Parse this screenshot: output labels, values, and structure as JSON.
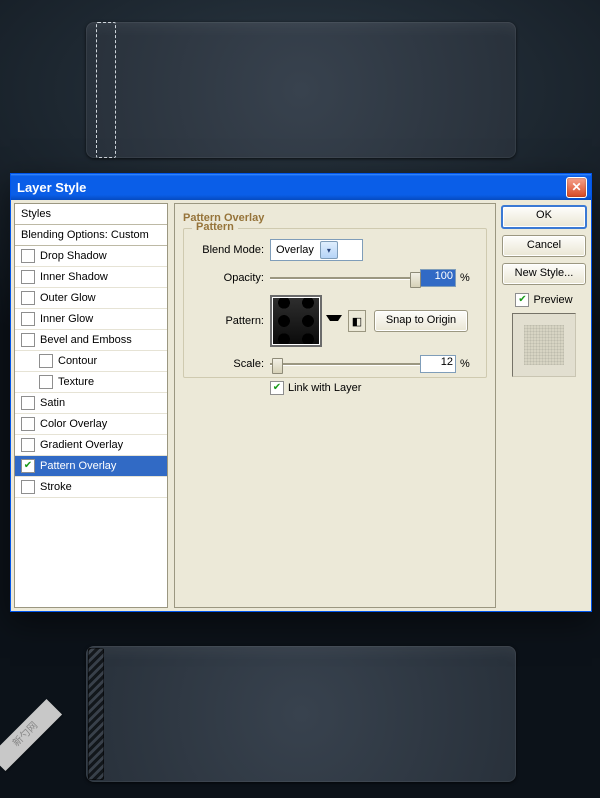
{
  "watermark": "新勺网",
  "dialog": {
    "title": "Layer Style",
    "left": {
      "header": "Styles",
      "sub": "Blending Options: Custom",
      "items": [
        {
          "label": "Drop Shadow",
          "checked": false
        },
        {
          "label": "Inner Shadow",
          "checked": false
        },
        {
          "label": "Outer Glow",
          "checked": false
        },
        {
          "label": "Inner Glow",
          "checked": false
        },
        {
          "label": "Bevel and Emboss",
          "checked": false
        },
        {
          "label": "Contour",
          "checked": false,
          "indent": true
        },
        {
          "label": "Texture",
          "checked": false,
          "indent": true
        },
        {
          "label": "Satin",
          "checked": false
        },
        {
          "label": "Color Overlay",
          "checked": false
        },
        {
          "label": "Gradient Overlay",
          "checked": false
        },
        {
          "label": "Pattern Overlay",
          "checked": true,
          "selected": true
        },
        {
          "label": "Stroke",
          "checked": false
        }
      ]
    },
    "group": {
      "title": "Pattern Overlay",
      "legend": "Pattern",
      "blend_label": "Blend Mode:",
      "blend_value": "Overlay",
      "opacity_label": "Opacity:",
      "opacity_value": "100",
      "opacity_unit": "%",
      "pattern_label": "Pattern:",
      "snap_label": "Snap to Origin",
      "scale_label": "Scale:",
      "scale_value": "12",
      "scale_unit": "%",
      "link_label": "Link with Layer",
      "link_checked": true
    },
    "buttons": {
      "ok": "OK",
      "cancel": "Cancel",
      "new_style": "New Style...",
      "preview_label": "Preview",
      "preview_checked": true
    }
  }
}
